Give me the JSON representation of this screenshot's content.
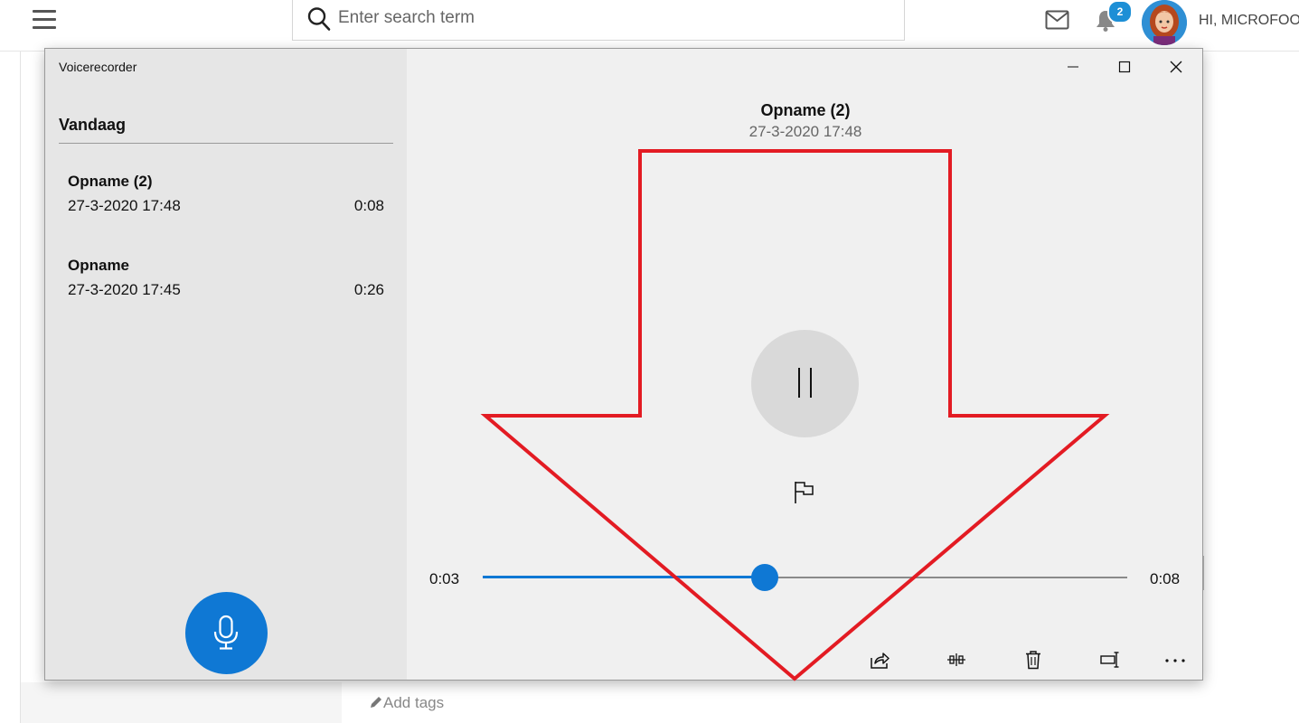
{
  "site": {
    "search_placeholder": "Enter search term",
    "notification_count": "2",
    "user_greeting": "HI, MICROFOON",
    "add_tags_label": "Add tags",
    "icons": [
      "menu-icon",
      "search-icon",
      "mail-icon",
      "bell-icon",
      "pencil-icon"
    ]
  },
  "window": {
    "title": "Voicerecorder",
    "section_header": "Vandaag",
    "recordings": [
      {
        "name": "Opname (2)",
        "date": "27-3-2020 17:48",
        "duration": "0:08"
      },
      {
        "name": "Opname",
        "date": "27-3-2020 17:45",
        "duration": "0:26"
      }
    ],
    "current": {
      "name": "Opname (2)",
      "date": "27-3-2020 17:48",
      "elapsed": "0:03",
      "total": "0:08",
      "progress_seconds": 3,
      "total_seconds": 8
    },
    "colors": {
      "accent": "#0f78d4",
      "sidebar_bg": "#e6e6e6",
      "player_bg": "#f0f0f0",
      "annotation_red": "#e31b23"
    },
    "icons": [
      "microphone-icon",
      "pause-icon",
      "flag-icon",
      "share-icon",
      "trim-icon",
      "delete-icon",
      "rename-icon",
      "more-icon",
      "minimize-icon",
      "maximize-icon",
      "close-icon"
    ]
  }
}
